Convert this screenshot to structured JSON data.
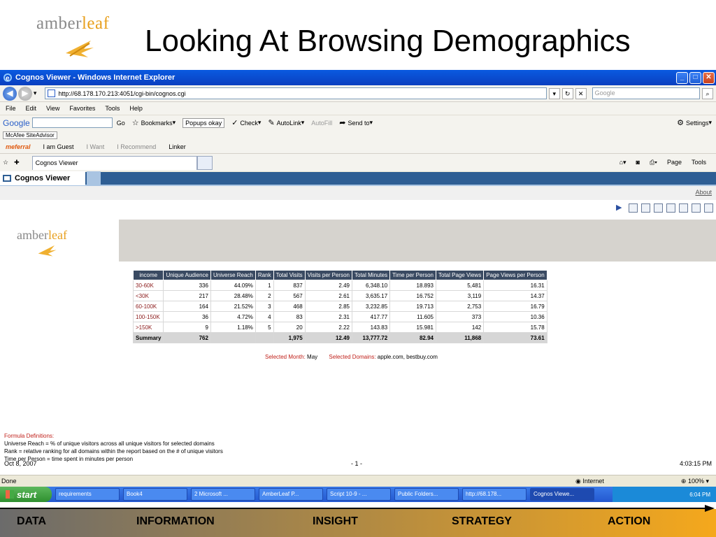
{
  "slide": {
    "brand_part1": "amber",
    "brand_part2": "leaf",
    "title": "Looking At Browsing Demographics"
  },
  "window": {
    "title": "Cognos Viewer - Windows Internet Explorer",
    "address": "http://68.178.170.213:4051/cgi-bin/cognos.cgi",
    "search_placeholder": "Google",
    "menu": [
      "File",
      "Edit",
      "View",
      "Favorites",
      "Tools",
      "Help"
    ],
    "google_toolbar": {
      "logo": "Google",
      "go": "Go",
      "bookmarks": "Bookmarks",
      "popups": "Popups okay",
      "check": "Check",
      "autolink": "AutoLink",
      "autofill": "AutoFill",
      "sendto": "Send to",
      "settings": "Settings"
    },
    "mcafee": "McAfee SiteAdvisor",
    "meferral": {
      "logo": "meferral",
      "guest": "I am Guest",
      "want": "I Want",
      "recommend": "I Recommend",
      "linker": "Linker"
    },
    "tab_label": "Cognos Viewer",
    "tab_tools": [
      "Page",
      "Tools"
    ],
    "status": "Done",
    "zone": "Internet",
    "zoom": "100%"
  },
  "viewer": {
    "header": "Cognos Viewer",
    "about": "About",
    "logo_part1": "amber",
    "logo_part2": "leaf"
  },
  "report": {
    "columns": [
      "income",
      "Unique Audience",
      "Universe Reach",
      "Rank",
      "Total Visits",
      "Visits per Person",
      "Total Minutes",
      "Time per Person",
      "Total Page Views",
      "Page Views per Person"
    ],
    "rows": [
      [
        "30-60K",
        "336",
        "44.09%",
        "1",
        "837",
        "2.49",
        "6,348.10",
        "18.893",
        "5,481",
        "16.31"
      ],
      [
        "<30K",
        "217",
        "28.48%",
        "2",
        "567",
        "2.61",
        "3,635.17",
        "16.752",
        "3,119",
        "14.37"
      ],
      [
        "60-100K",
        "164",
        "21.52%",
        "3",
        "468",
        "2.85",
        "3,232.85",
        "19.713",
        "2,753",
        "16.79"
      ],
      [
        "100-150K",
        "36",
        "4.72%",
        "4",
        "83",
        "2.31",
        "417.77",
        "11.605",
        "373",
        "10.36"
      ],
      [
        ">150K",
        "9",
        "1.18%",
        "5",
        "20",
        "2.22",
        "143.83",
        "15.981",
        "142",
        "15.78"
      ]
    ],
    "summary": [
      "Summary",
      "762",
      "",
      "",
      "1,975",
      "12.49",
      "13,777.72",
      "82.94",
      "11,868",
      "73.61"
    ],
    "selected_month_label": "Selected Month:",
    "selected_month": "May",
    "selected_domains_label": "Selected Domains:",
    "selected_domains": "apple.com, bestbuy.com",
    "formula_title": "Formula Definitions:",
    "formulas": [
      "Universe Reach = % of unique visitors across all unique visitors for selected domains",
      "Rank = relative ranking for all domains within the report based on the # of unique visitors",
      "Time per Person = time spent in minutes per person"
    ],
    "footer_date": "Oct 8, 2007",
    "footer_page": "- 1 -",
    "footer_time": "4:03:15 PM"
  },
  "taskbar": {
    "start": "start",
    "tasks": [
      "requirements",
      "Book4",
      "2 Microsoft ...",
      "AmberLeaf P...",
      "Script 10-9 - ...",
      "Public Folders...",
      "http://68.178...",
      "Cognos Viewe..."
    ],
    "clock": "6:04 PM"
  },
  "process": {
    "stages": [
      "DATA",
      "INFORMATION",
      "INSIGHT",
      "STRATEGY",
      "ACTION"
    ],
    "colors": {
      "start": "#6b6b6b",
      "end": "#f5a81c"
    }
  }
}
